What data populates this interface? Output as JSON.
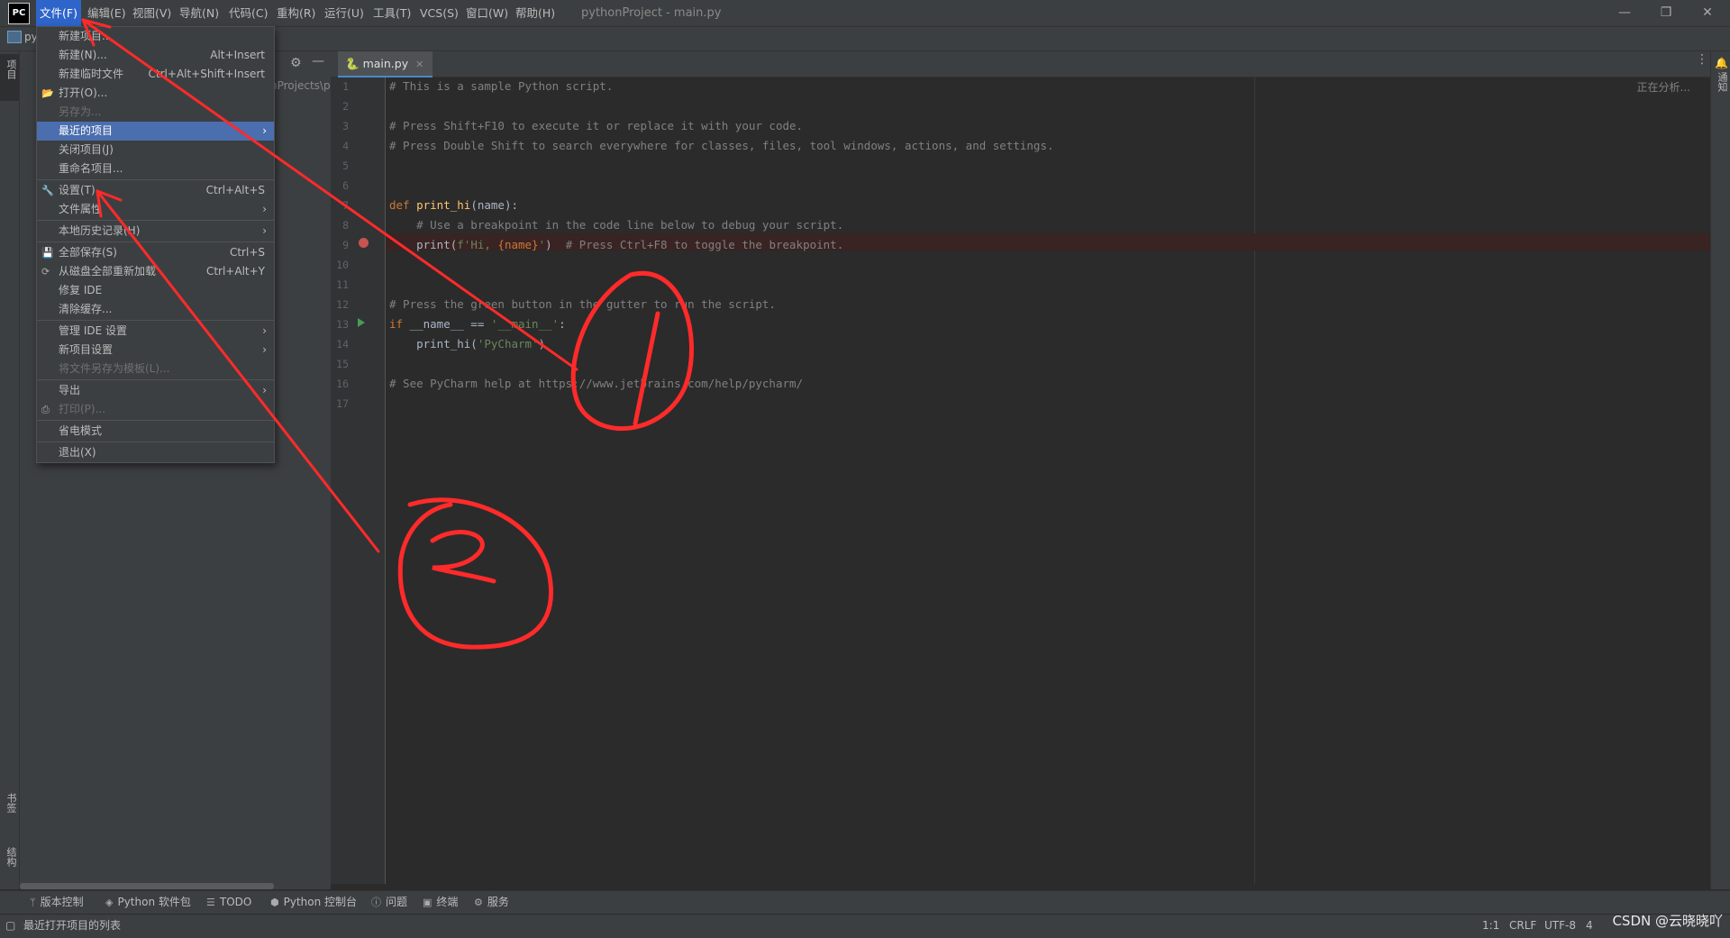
{
  "menubar": {
    "items": [
      "文件(F)",
      "编辑(E)",
      "视图(V)",
      "导航(N)",
      "代码(C)",
      "重构(R)",
      "运行(U)",
      "工具(T)",
      "VCS(S)",
      "窗口(W)",
      "帮助(H)"
    ],
    "window_title": "pythonProject - main.py",
    "logo": "PC"
  },
  "window_controls": {
    "minimize": "—",
    "restore": "❐",
    "close": "✕"
  },
  "project_panel": {
    "path_fragment": "nProjects\\p",
    "label_fragment": "py"
  },
  "left_strip": {
    "project": "项目",
    "bookmarks": "书签",
    "structure": "结构"
  },
  "right_strip": {
    "notifications": "通知"
  },
  "file_menu": {
    "items": [
      {
        "label": "新建项目...",
        "shortcut": "",
        "disabled": false
      },
      {
        "label": "新建(N)...",
        "shortcut": "Alt+Insert",
        "disabled": false
      },
      {
        "label": "新建临时文件",
        "shortcut": "Ctrl+Alt+Shift+Insert",
        "disabled": false
      },
      {
        "label": "打开(O)...",
        "shortcut": "",
        "disabled": false,
        "icon": "folder-icon"
      },
      {
        "label": "另存为...",
        "shortcut": "",
        "disabled": true
      },
      {
        "label": "最近的项目",
        "shortcut": "",
        "disabled": false,
        "submenu": true,
        "highlight": true
      },
      {
        "label": "关闭项目(J)",
        "shortcut": "",
        "disabled": false
      },
      {
        "label": "重命名项目...",
        "shortcut": "",
        "disabled": false
      },
      {
        "label": "设置(T)...",
        "shortcut": "Ctrl+Alt+S",
        "disabled": false,
        "icon": "wrench-icon"
      },
      {
        "label": "文件属性",
        "shortcut": "",
        "disabled": false,
        "submenu": true
      },
      {
        "label": "本地历史记录(H)",
        "shortcut": "",
        "disabled": false,
        "submenu": true
      },
      {
        "label": "全部保存(S)",
        "shortcut": "Ctrl+S",
        "disabled": false,
        "icon": "save-icon"
      },
      {
        "label": "从磁盘全部重新加载",
        "shortcut": "Ctrl+Alt+Y",
        "disabled": false,
        "icon": "reload-icon"
      },
      {
        "label": "修复 IDE",
        "shortcut": "",
        "disabled": false
      },
      {
        "label": "清除缓存...",
        "shortcut": "",
        "disabled": false
      },
      {
        "label": "管理 IDE 设置",
        "shortcut": "",
        "disabled": false,
        "submenu": true
      },
      {
        "label": "新项目设置",
        "shortcut": "",
        "disabled": false,
        "submenu": true
      },
      {
        "label": "将文件另存为模板(L)...",
        "shortcut": "",
        "disabled": true
      },
      {
        "label": "导出",
        "shortcut": "",
        "disabled": false,
        "submenu": true
      },
      {
        "label": "打印(P)...",
        "shortcut": "",
        "disabled": true,
        "icon": "print-icon"
      },
      {
        "label": "省电模式",
        "shortcut": "",
        "disabled": false
      },
      {
        "label": "退出(X)",
        "shortcut": "",
        "disabled": false
      }
    ]
  },
  "editor": {
    "tab": "main.py",
    "analyzing": "正在分析...",
    "line_numbers": [
      "1",
      "2",
      "3",
      "4",
      "5",
      "6",
      "7",
      "8",
      "9",
      "10",
      "11",
      "12",
      "13",
      "14",
      "15",
      "16",
      "17"
    ],
    "code": {
      "l1": "# This is a sample Python script.",
      "l3": "# Press Shift+F10 to execute it or replace it with your code.",
      "l4": "# Press Double Shift to search everywhere for classes, files, tool windows, actions, and settings.",
      "l7_kw": "def ",
      "l7_fn": "print_hi",
      "l7_rest": "(name):",
      "l8": "    # Use a breakpoint in the code line below to debug your script.",
      "l9_a": "    print(",
      "l9_str": "f'Hi, ",
      "l9_brace": "{name}",
      "l9_str2": "'",
      "l9_b": ")  ",
      "l9_cm": "# Press Ctrl+F8 to toggle the breakpoint.",
      "l12": "# Press the green button in the gutter to run the script.",
      "l13_kw": "if ",
      "l13_a": "__name__ == ",
      "l13_str": "'__main__'",
      "l13_b": ":",
      "l14_a": "    print_hi(",
      "l14_str": "'PyCharm'",
      "l14_b": ")",
      "l16": "# See PyCharm help at https://www.jetbrains.com/help/pycharm/"
    }
  },
  "bottom_tools": [
    "版本控制",
    "Python 软件包",
    "TODO",
    "Python 控制台",
    "问题",
    "终端",
    "服务"
  ],
  "status": {
    "message": "最近打开项目的列表",
    "position": "1:1",
    "line_sep": "CRLF",
    "encoding": "UTF-8",
    "indent": "4",
    "watermark": "CSDN @云晓晓吖"
  },
  "annotations": {
    "circle_1": "1",
    "circle_2": "2",
    "arrow_color": "#ff2a2a"
  }
}
